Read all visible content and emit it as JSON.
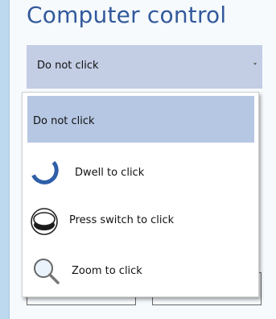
{
  "header": {
    "title": "Computer control"
  },
  "control_select": {
    "value": "Do not click"
  },
  "dropdown": {
    "options": [
      {
        "label": "Do not click",
        "icon": "",
        "selected": true
      },
      {
        "label": "Dwell to click",
        "icon": "dwell-ring-icon",
        "selected": false
      },
      {
        "label": "Press switch to click",
        "icon": "switch-button-icon",
        "selected": false
      },
      {
        "label": "Zoom to click",
        "icon": "magnifier-icon",
        "selected": false
      }
    ]
  },
  "colors": {
    "background": "#bcd9f0",
    "panel": "#f6fafd",
    "title": "#33599c",
    "select_bg": "#c3cde4",
    "selected_option_bg": "#b6c7e3",
    "accent_blue": "#2f5fa8"
  }
}
